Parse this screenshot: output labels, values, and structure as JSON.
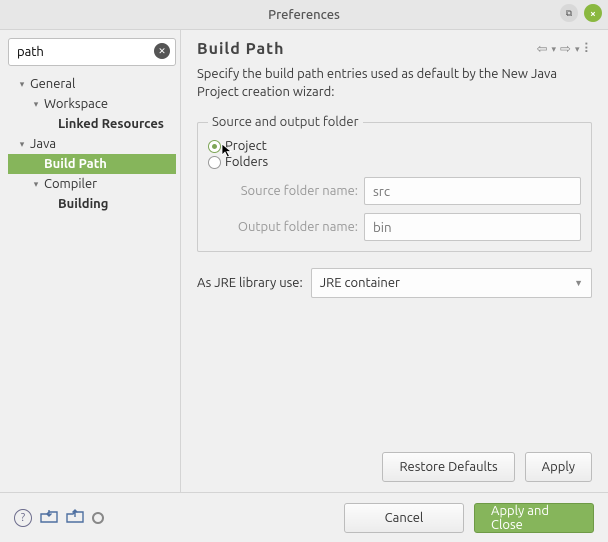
{
  "window": {
    "title": "Preferences"
  },
  "search": {
    "value": "path"
  },
  "tree": {
    "general": "General",
    "workspace": "Workspace",
    "linked": "Linked Resources",
    "java": "Java",
    "buildpath": "Build Path",
    "compiler": "Compiler",
    "building": "Building"
  },
  "page": {
    "title": "Build  Path",
    "desc": "Specify the build path entries used as default by the New Java Project creation wizard:",
    "fieldset_legend": "Source and output folder",
    "radio_project": "Project",
    "radio_folders": "Folders",
    "source_label": "Source folder name:",
    "source_value": "src",
    "output_label": "Output folder name:",
    "output_value": "bin",
    "jre_label": "As JRE library use:",
    "jre_value": "JRE container"
  },
  "buttons": {
    "restore": "Restore Defaults",
    "apply": "Apply",
    "cancel": "Cancel",
    "apply_close": "Apply and Close"
  }
}
